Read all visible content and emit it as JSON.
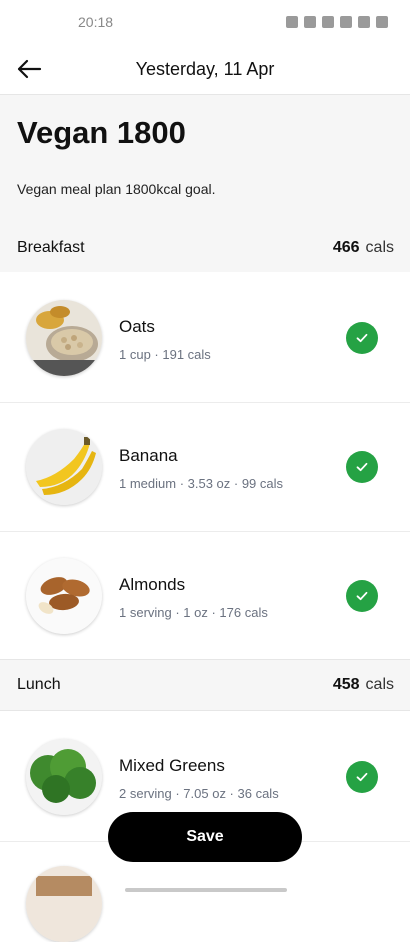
{
  "status_bar": {
    "time": "20:18"
  },
  "header": {
    "title": "Yesterday, 11 Apr"
  },
  "plan": {
    "title": "Vegan 1800",
    "description": "Vegan meal plan 1800kcal goal."
  },
  "breakfast": {
    "label": "Breakfast",
    "cals_value": "466",
    "cals_unit": "cals",
    "items": [
      {
        "name": "Oats",
        "meta": "1 cup · 191 cals",
        "icon": "oats-image"
      },
      {
        "name": "Banana",
        "meta": "1 medium · 3.53 oz · 99 cals",
        "icon": "banana-image"
      },
      {
        "name": "Almonds",
        "meta": "1 serving · 1 oz · 176 cals",
        "icon": "almonds-image"
      }
    ]
  },
  "lunch": {
    "label": "Lunch",
    "cals_value": "458",
    "cals_unit": "cals",
    "items": [
      {
        "name": "Mixed Greens",
        "meta": "2 serving · 7.05 oz · 36 cals",
        "icon": "greens-image"
      }
    ]
  },
  "actions": {
    "save_label": "Save"
  },
  "colors": {
    "check_green": "#25a244",
    "button_black": "#000000",
    "section_bg": "#f6f6f6"
  }
}
